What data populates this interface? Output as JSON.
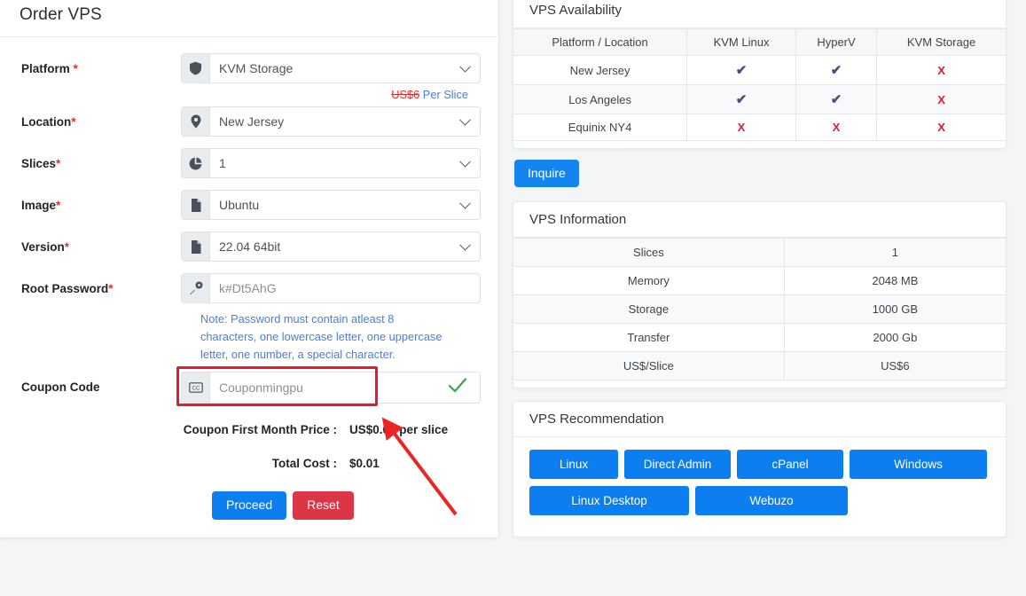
{
  "order_card": {
    "title": "Order VPS",
    "fields": [
      {
        "label": "Platform ",
        "required": "*",
        "icon": "shield-icon",
        "value": "KVM Storage",
        "type": "select"
      },
      {
        "label": "Location",
        "required": "*",
        "icon": "map-pin-icon",
        "value": "New Jersey",
        "type": "select"
      },
      {
        "label": "Slices",
        "required": "*",
        "icon": "pie-chart-icon",
        "value": "1",
        "type": "select"
      },
      {
        "label": "Image",
        "required": "*",
        "icon": "file-icon",
        "value": "Ubuntu",
        "type": "select"
      },
      {
        "label": "Version",
        "required": "*",
        "icon": "file-icon",
        "value": "22.04 64bit",
        "type": "select"
      },
      {
        "label": "Root Password",
        "required": "*",
        "icon": "key-icon",
        "value": "k#Dt5AhG",
        "type": "text"
      }
    ],
    "platform_price": {
      "strikethrough": "US$6",
      "suffix": " Per Slice"
    },
    "password_note": "Note: Password must contain atleast 8 characters, one lowercase letter, one uppercase letter, one number, a special character.",
    "coupon": {
      "label": "Coupon Code",
      "icon": "coupon-cc-icon",
      "value": "Couponmingpu",
      "valid_icon": "check-icon"
    },
    "coupon_price": {
      "label": "Coupon First Month Price :",
      "value": "US$0.01 per slice"
    },
    "total_cost": {
      "label": "Total Cost :",
      "value": "$0.01"
    },
    "buttons": {
      "proceed": "Proceed",
      "reset": "Reset"
    }
  },
  "availability": {
    "title": "VPS Availability",
    "headers": [
      "Platform / Location",
      "KVM Linux",
      "HyperV",
      "KVM Storage"
    ],
    "rows": [
      {
        "location": "New Jersey",
        "kvm_linux": "yes",
        "hyperv": "yes",
        "kvm_storage": "no"
      },
      {
        "location": "Los Angeles",
        "kvm_linux": "yes",
        "hyperv": "yes",
        "kvm_storage": "no"
      },
      {
        "location": "Equinix NY4",
        "kvm_linux": "no",
        "hyperv": "no",
        "kvm_storage": "no"
      }
    ],
    "yes_glyph": "✔",
    "no_glyph": "X",
    "inquire_label": "Inquire"
  },
  "vps_information": {
    "title": "VPS Information",
    "rows": [
      {
        "key": "Slices",
        "value": "1"
      },
      {
        "key": "Memory",
        "value": "2048 MB"
      },
      {
        "key": "Storage",
        "value": "1000 GB"
      },
      {
        "key": "Transfer",
        "value": "2000 Gb"
      },
      {
        "key": "US$/Slice",
        "value": "US$6"
      }
    ]
  },
  "recommendation": {
    "title": "VPS Recommendation",
    "row1": [
      "Linux",
      "Direct Admin",
      "cPanel",
      "Windows"
    ],
    "row2": [
      "Linux Desktop",
      "Webuzo"
    ]
  },
  "colors": {
    "primary_blue": "#0d7ef0",
    "danger_red": "#dc3545",
    "annotation_red": "#e8192c",
    "note_blue": "#4a7fd6",
    "check_green": "#2cab4b",
    "mark_yes": "#4c4f7d"
  }
}
